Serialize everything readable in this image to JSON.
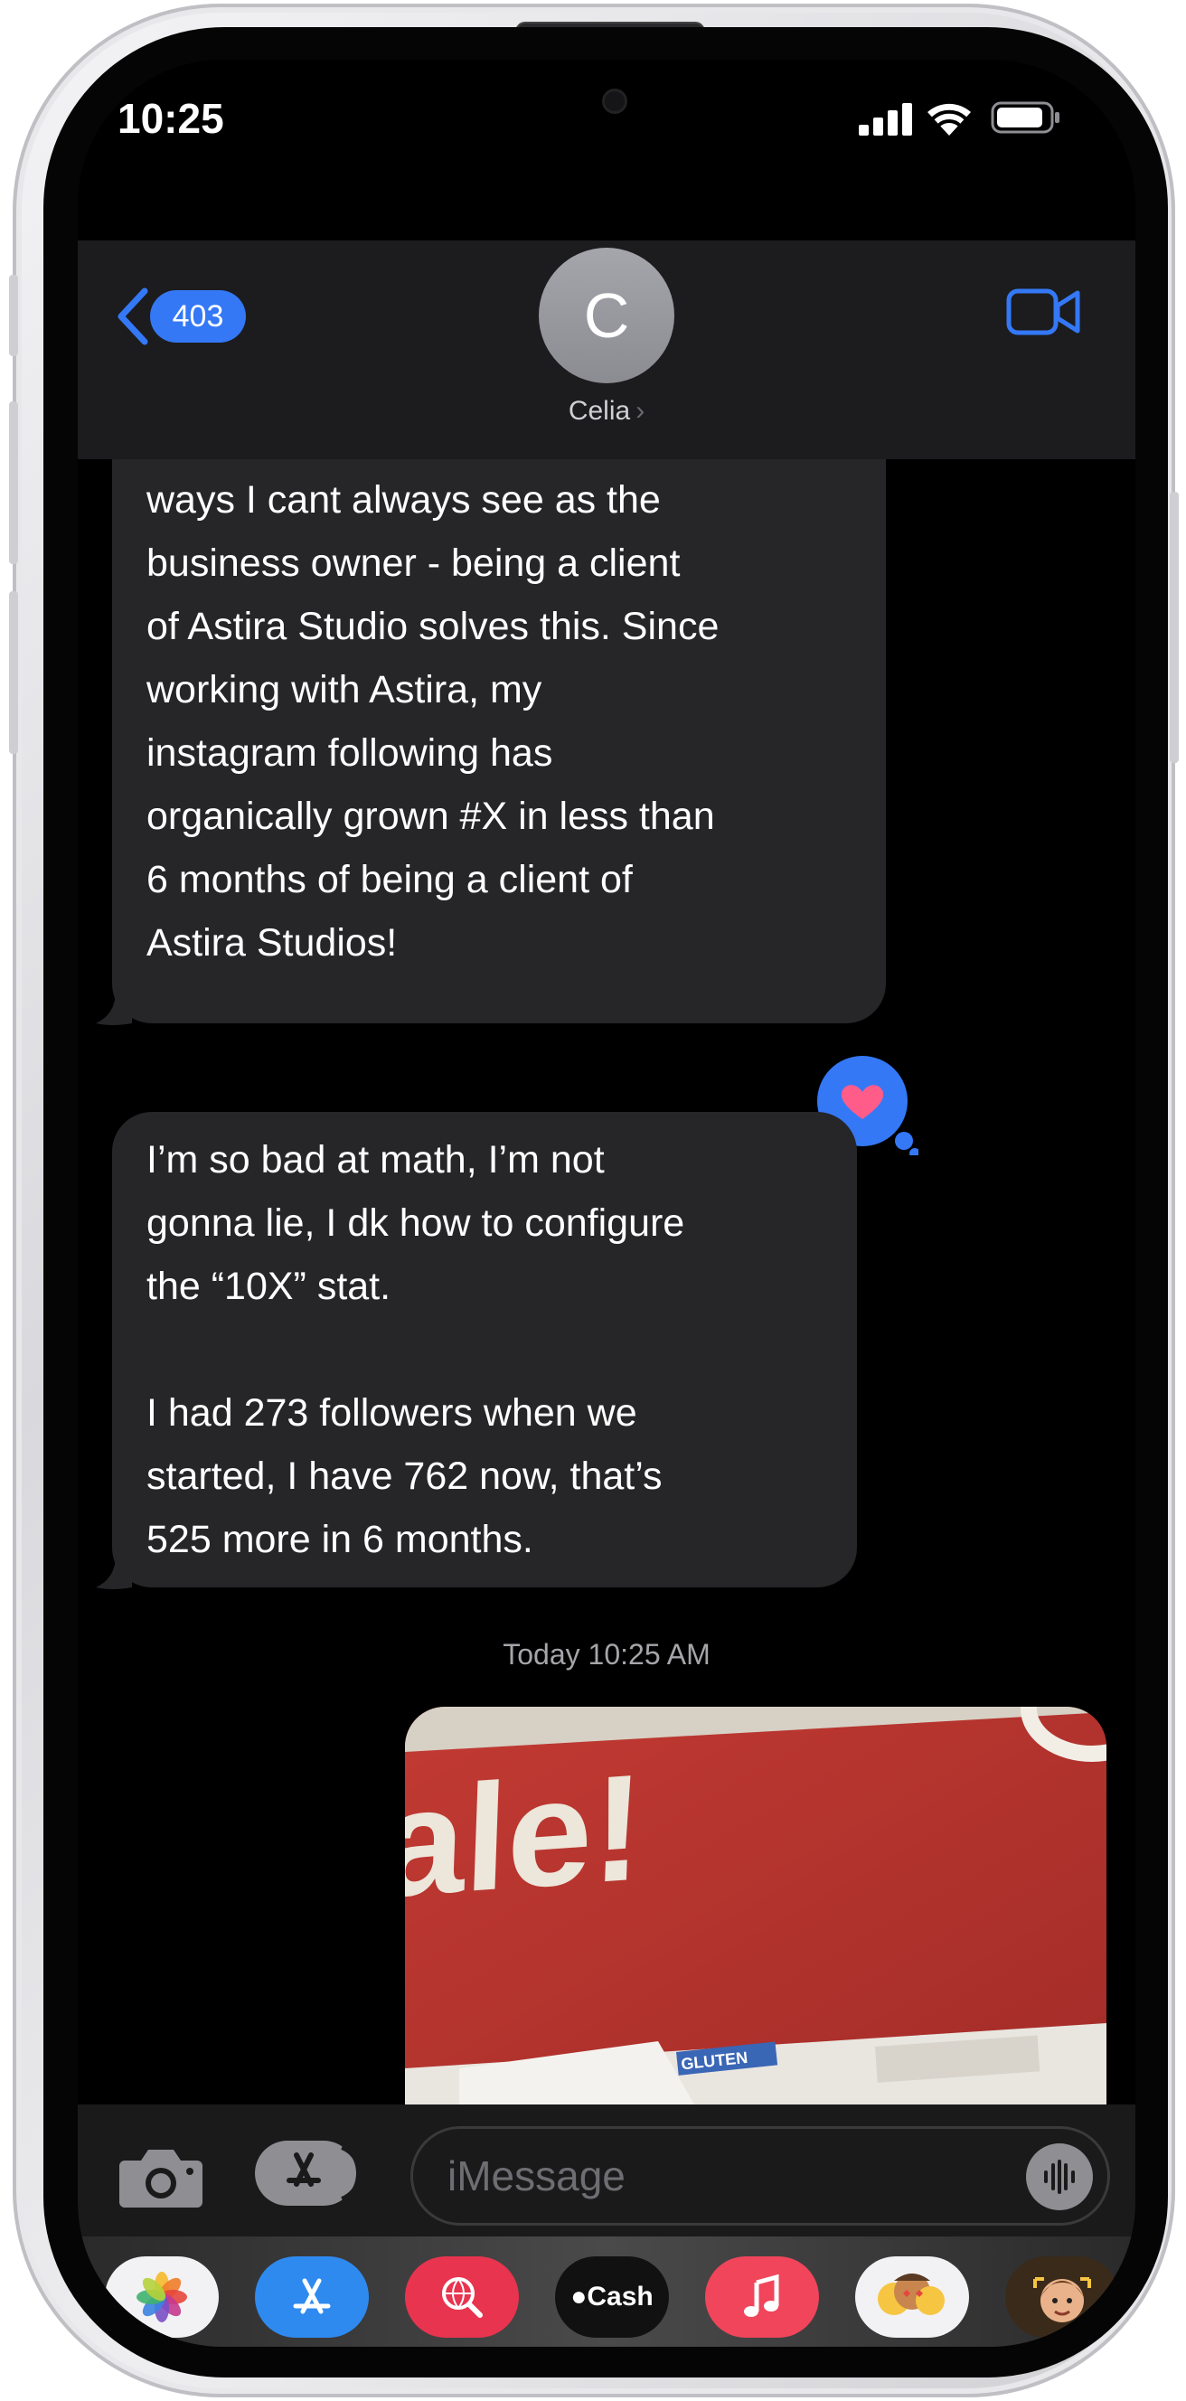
{
  "status_bar": {
    "time": "10:25"
  },
  "header": {
    "back_count": "403",
    "avatar_initial": "C",
    "contact_name": "Celia",
    "contact_chevron": "›"
  },
  "messages": [
    {
      "direction": "incoming",
      "text": "My jewelry brand is young and\nneeds to be elevated in certain\nways I cant always see as the\nbusiness owner - being a client\nof Astira Studio solves this. Since\nworking with Astira, my\ninstagram following has\norganically grown #X in less than\n6 months of being a client of\nAstira Studios!"
    },
    {
      "direction": "incoming",
      "text": "I’m so bad at math, I’m not\ngonna lie, I dk how to configure\nthe “10X” stat.\n\nI had 273 followers when we\nstarted, I have 762 now, that’s\n525 more in 6 months.",
      "reaction": "heart"
    }
  ],
  "timestamp": "Today 10:25 AM",
  "photo": {
    "sign_text": "ale!",
    "label_text": "GLUTEN"
  },
  "input": {
    "placeholder": "iMessage"
  },
  "app_drawer": [
    {
      "name": "photos-app-icon"
    },
    {
      "name": "app-store-icon"
    },
    {
      "name": "image-search-icon"
    },
    {
      "name": "apple-cash-icon",
      "label": "Cash"
    },
    {
      "name": "music-icon"
    },
    {
      "name": "memoji-stickers-icon"
    },
    {
      "name": "memoji-icon"
    }
  ],
  "colors": {
    "accent": "#3478f6",
    "bubble_incoming": "#262628",
    "tapback_heart": "#ff5c8a"
  }
}
